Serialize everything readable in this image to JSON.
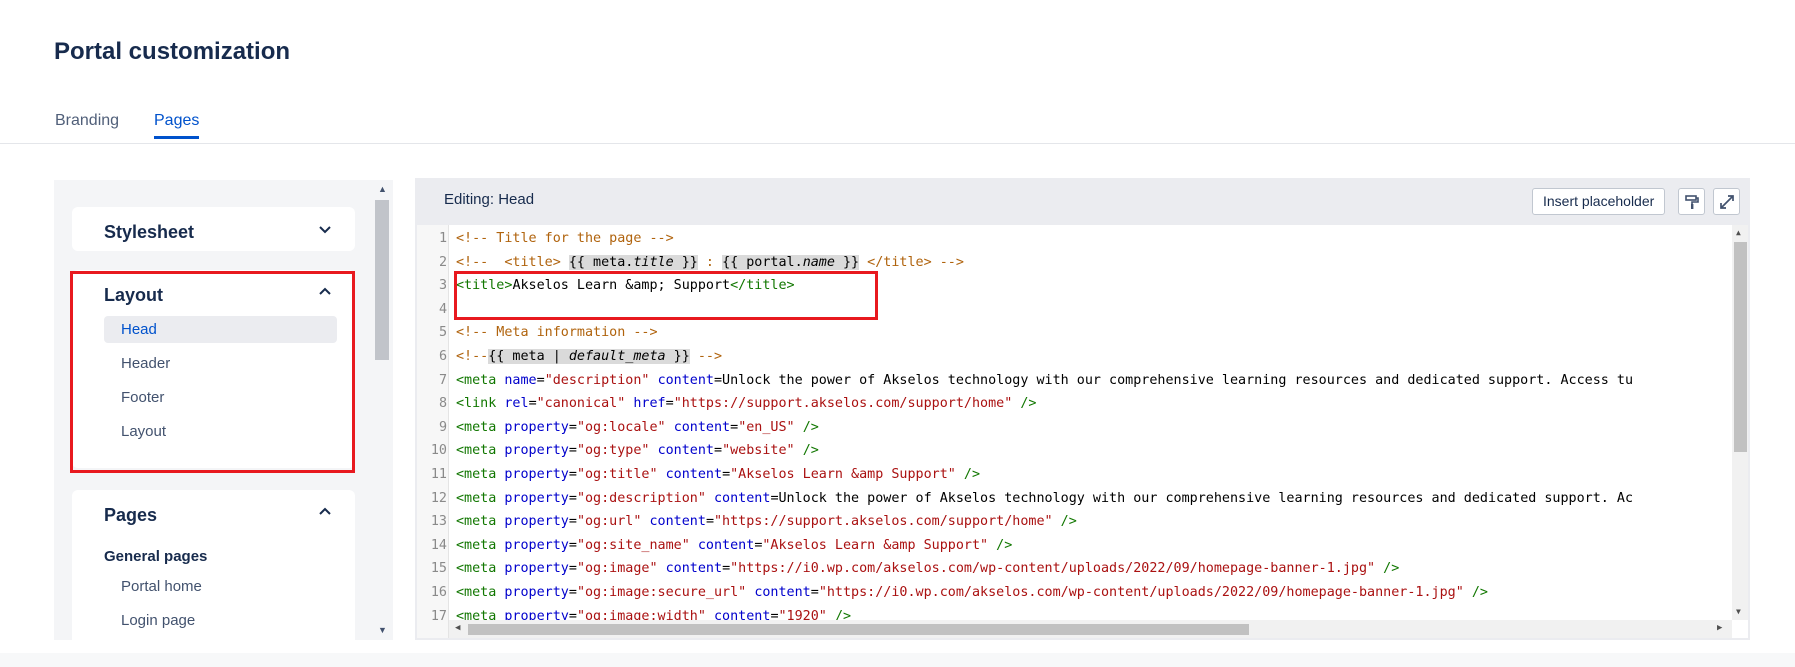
{
  "page": {
    "title": "Portal customization"
  },
  "tabs": [
    {
      "label": "Branding",
      "active": false
    },
    {
      "label": "Pages",
      "active": true
    }
  ],
  "sidebar": {
    "stylesheet": {
      "label": "Stylesheet",
      "expanded": false
    },
    "layout": {
      "label": "Layout",
      "expanded": true,
      "items": [
        "Head",
        "Header",
        "Footer",
        "Layout"
      ],
      "selected": "Head"
    },
    "pages": {
      "label": "Pages",
      "expanded": true,
      "subheading": "General pages",
      "items": [
        "Portal home",
        "Login page"
      ]
    }
  },
  "editor": {
    "title": "Editing: Head",
    "insert_label": "Insert placeholder",
    "icons": [
      "format-brush-icon",
      "expand-icon"
    ],
    "line_numbers": [
      "1",
      "2",
      "3",
      "4",
      "5",
      "6",
      "7",
      "8",
      "9",
      "10",
      "11",
      "12",
      "13",
      "14",
      "15",
      "16",
      "17"
    ],
    "lines": [
      "<!-- Title for the page -->",
      "<!--  <title> {{ meta.title }} : {{ portal.name }} </title> -->",
      "<title>Akselos Learn &amp; Support</title>",
      "",
      "<!-- Meta information -->",
      "<!--{{ meta | default_meta }} -->",
      "<meta name=\"description\" content=\"Unlock the power of Akselos technology with our comprehensive learning resources and dedicated support. Access tu",
      "<link rel=\"canonical\" href=\"https://support.akselos.com/support/home\" />",
      "<meta property=\"og:locale\" content=\"en_US\" />",
      "<meta property=\"og:type\" content=\"website\" />",
      "<meta property=\"og:title\" content=\"Akselos Learn &amp Support\" />",
      "<meta property=\"og:description\" content=\"Unlock the power of Akselos technology with our comprehensive learning resources and dedicated support. Ac",
      "<meta property=\"og:url\" content=\"https://support.akselos.com/support/home\" />",
      "<meta property=\"og:site_name\" content=\"Akselos Learn &amp Support\" />",
      "<meta property=\"og:image\" content=\"https://i0.wp.com/akselos.com/wp-content/uploads/2022/09/homepage-banner-1.jpg\" />",
      "<meta property=\"og:image:secure_url\" content=\"https://i0.wp.com/akselos.com/wp-content/uploads/2022/09/homepage-banner-1.jpg\" />",
      "<meta property=\"og:image:width\" content=\"1920\" />"
    ]
  },
  "colors": {
    "accent": "#0052cc",
    "highlight": "#e8191f",
    "comment": "#b0630d",
    "tag": "#117700",
    "attribute": "#0000cc",
    "string": "#aa1111"
  }
}
